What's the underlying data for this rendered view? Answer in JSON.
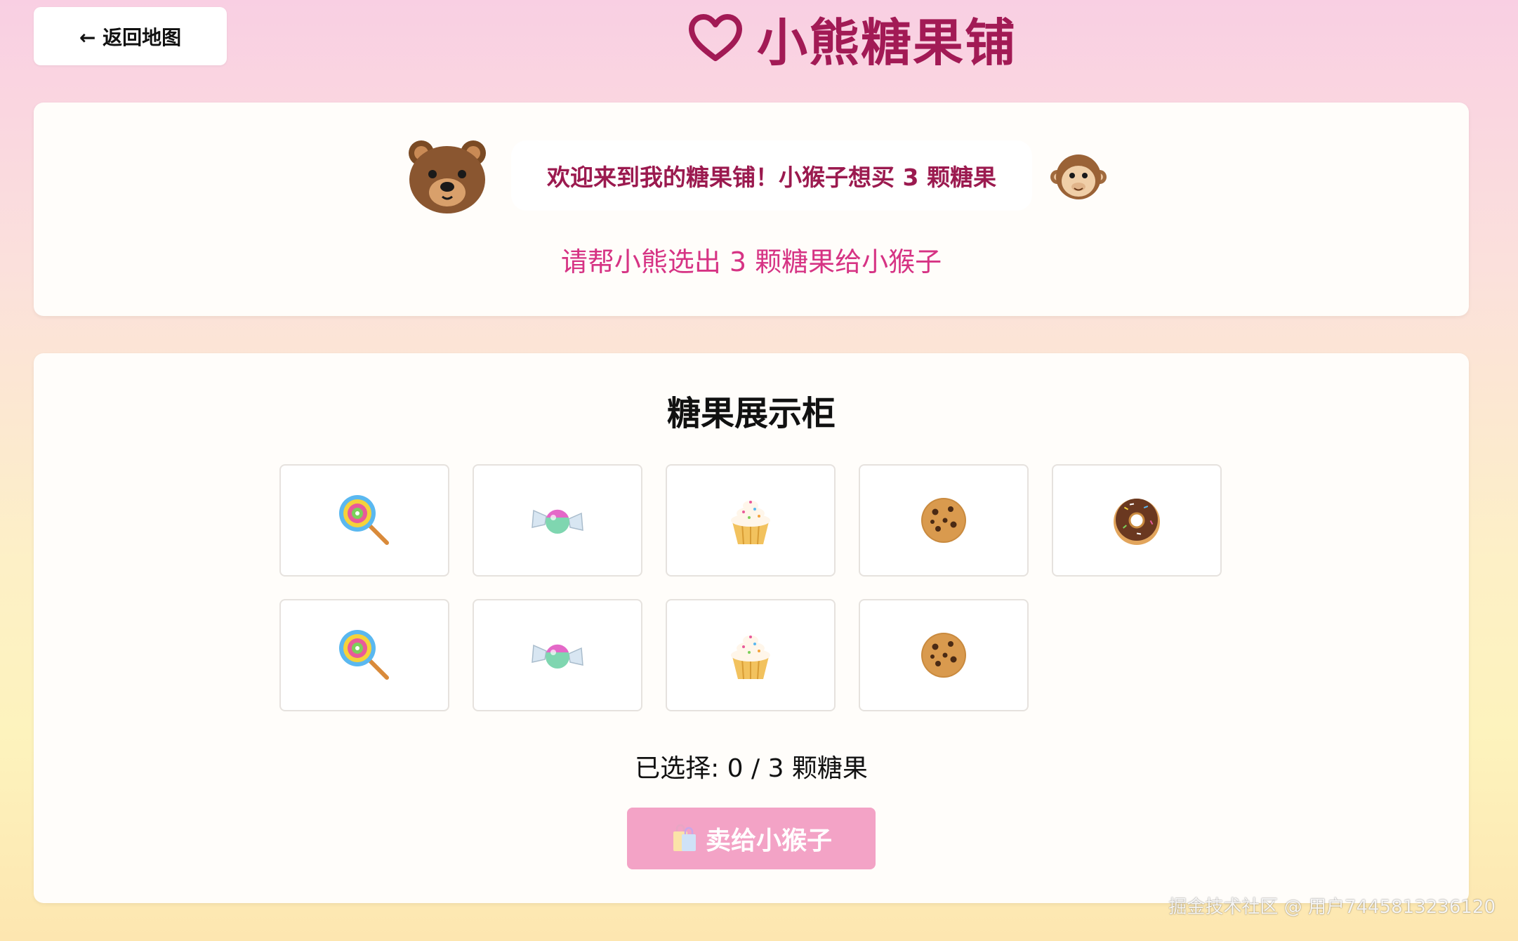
{
  "nav": {
    "back_label": "← 返回地图"
  },
  "header": {
    "title": "小熊糖果铺",
    "icon": "heart-outline-icon",
    "color": "#a21a55"
  },
  "welcome": {
    "bubble_text": "欢迎来到我的糖果铺！小猴子想买 3 颗糖果",
    "instruction": "请帮小熊选出 3 颗糖果给小猴子",
    "shopkeeper_icon": "bear-face-icon",
    "customer_icon": "monkey-face-icon"
  },
  "showcase": {
    "title": "糖果展示柜",
    "candies": [
      {
        "icon": "lollipop-icon"
      },
      {
        "icon": "candy-icon"
      },
      {
        "icon": "cupcake-icon"
      },
      {
        "icon": "cookie-icon"
      },
      {
        "icon": "doughnut-icon"
      },
      {
        "icon": "lollipop-icon"
      },
      {
        "icon": "candy-icon"
      },
      {
        "icon": "cupcake-icon"
      },
      {
        "icon": "cookie-icon"
      }
    ],
    "selection_status": "已选择: 0 / 3 颗糖果",
    "selected_count": 0,
    "required_count": 3,
    "sell_label": "卖给小猴子",
    "sell_icon": "shopping-bags-icon",
    "sell_button_color": "#f3a3c6"
  },
  "watermark": "掘金技术社区 @ 用户7445813236120"
}
